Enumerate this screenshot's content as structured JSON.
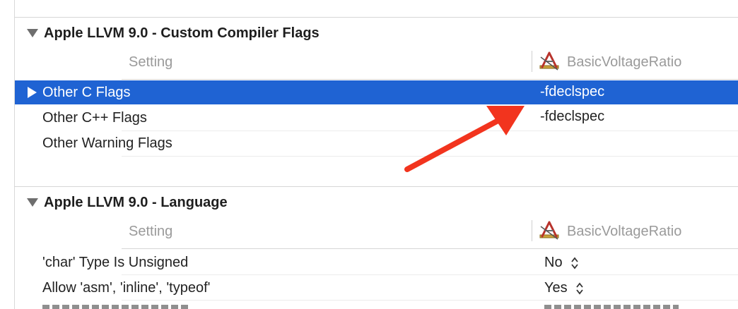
{
  "sections": [
    {
      "title": "Apple LLVM 9.0 - Custom Compiler Flags",
      "header": {
        "setting": "Setting",
        "target": "BasicVoltageRatio"
      },
      "rows": [
        {
          "name": "Other C Flags",
          "value": "-fdeclspec",
          "selected": true
        },
        {
          "name": "Other C++ Flags",
          "value": "-fdeclspec"
        },
        {
          "name": "Other Warning Flags",
          "value": ""
        }
      ]
    },
    {
      "title": "Apple LLVM 9.0 - Language",
      "header": {
        "setting": "Setting",
        "target": "BasicVoltageRatio"
      },
      "rows": [
        {
          "name": "'char' Type Is Unsigned",
          "value": "No"
        },
        {
          "name": "Allow 'asm', 'inline', 'typeof'",
          "value": "Yes"
        }
      ]
    }
  ],
  "colors": {
    "selection": "#1f63d3",
    "annotation_arrow": "#f2341e"
  },
  "icons": {
    "target": "xcode-target-icon",
    "disclosure_expanded": "disclosure-triangle-down-icon",
    "disclosure_collapsed": "disclosure-triangle-right-icon",
    "popup_stepper": "up-down-chevron-icon"
  }
}
